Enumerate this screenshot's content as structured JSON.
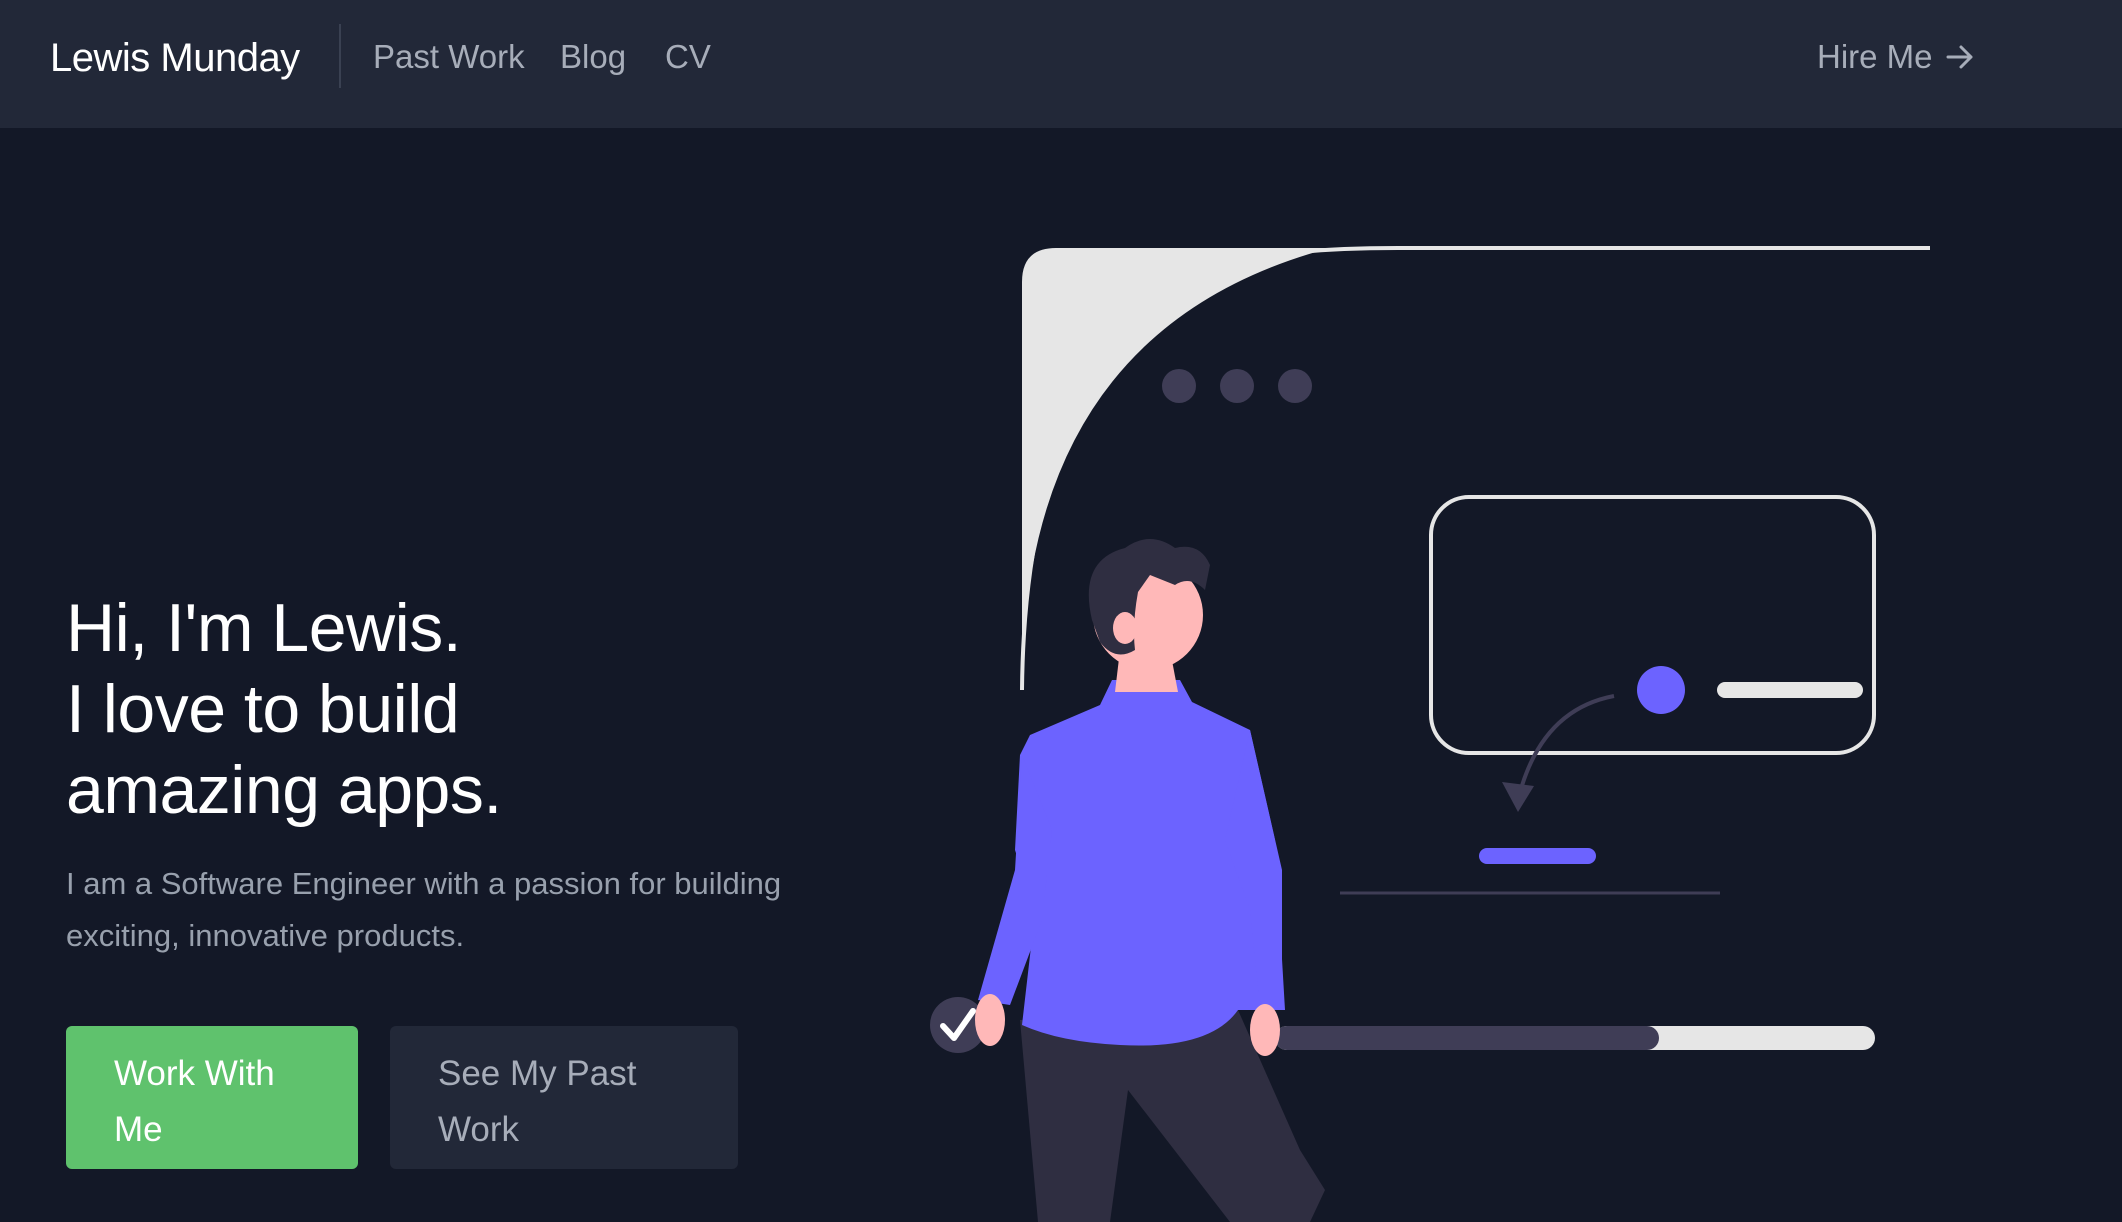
{
  "navbar": {
    "brand": "Lewis Munday",
    "links": [
      {
        "label": "Past Work"
      },
      {
        "label": "Blog"
      },
      {
        "label": "CV"
      }
    ],
    "cta_label": "Hire Me",
    "cta_icon": "arrow-right-icon"
  },
  "hero": {
    "title_lines": [
      "Hi, I'm Lewis.",
      "I love to build",
      "amazing apps."
    ],
    "subtitle": "I am a Software Engineer with a passion for building exciting, innovative products.",
    "primary_button": "Work With Me",
    "secondary_button": "See My Past Work"
  },
  "illustration": {
    "name": "person-with-browser-window-illustration",
    "progress_fraction": 0.64
  },
  "colors": {
    "page_background": "#131827",
    "navbar_background": "#222838",
    "accent_green": "#5fc26d",
    "accent_purple": "#6c63ff",
    "muted_text": "#a7adb9"
  }
}
